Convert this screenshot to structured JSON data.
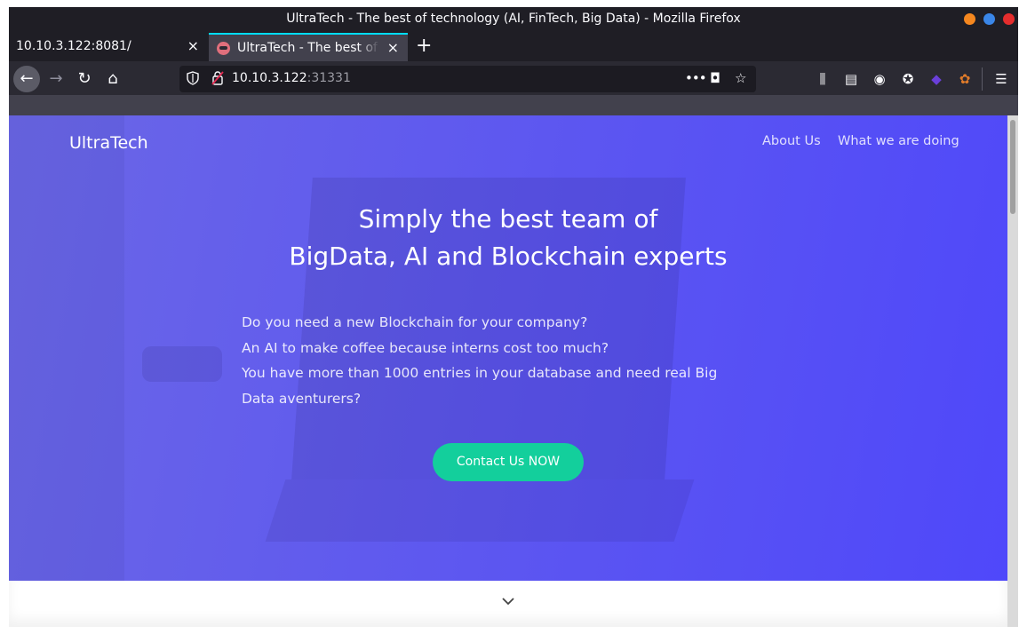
{
  "window": {
    "title": "UltraTech - The best of technology (AI, FinTech, Big Data) - Mozilla Firefox"
  },
  "tabs": [
    {
      "label": "10.10.3.122:8081/",
      "active": false
    },
    {
      "label": "UltraTech - The best of technology (AI, FinTech, Big Data)",
      "active": true
    }
  ],
  "urlbar": {
    "host": "10.10.3.122",
    "port": ":31331"
  },
  "icons": {
    "close": "×",
    "new_tab": "+",
    "back": "←",
    "forward": "→",
    "reload": "↻",
    "home": "⌂",
    "more": "•••",
    "pocket": "◘",
    "star": "☆",
    "library": "⫼",
    "sidebar": "▤",
    "account": "◉",
    "cookie": "✪",
    "ext1": "◆",
    "ext2": "✿",
    "menu": "☰"
  },
  "site": {
    "brand": "UltraTech",
    "nav": [
      "About Us",
      "What we are doing"
    ],
    "headline": [
      "Simply the best team of",
      "BigData, AI and Blockchain experts"
    ],
    "paragraph": [
      "Do you need a new Blockchain for your company?",
      "An AI to make coffee because interns cost too much?",
      "You have more than 1000 entries in your database and need real Big Data aventurers?"
    ],
    "cta": "Contact Us NOW"
  },
  "colors": {
    "hero": "#5d57f0",
    "cta": "#13cf9c",
    "tab_accent": "#00ddff"
  }
}
